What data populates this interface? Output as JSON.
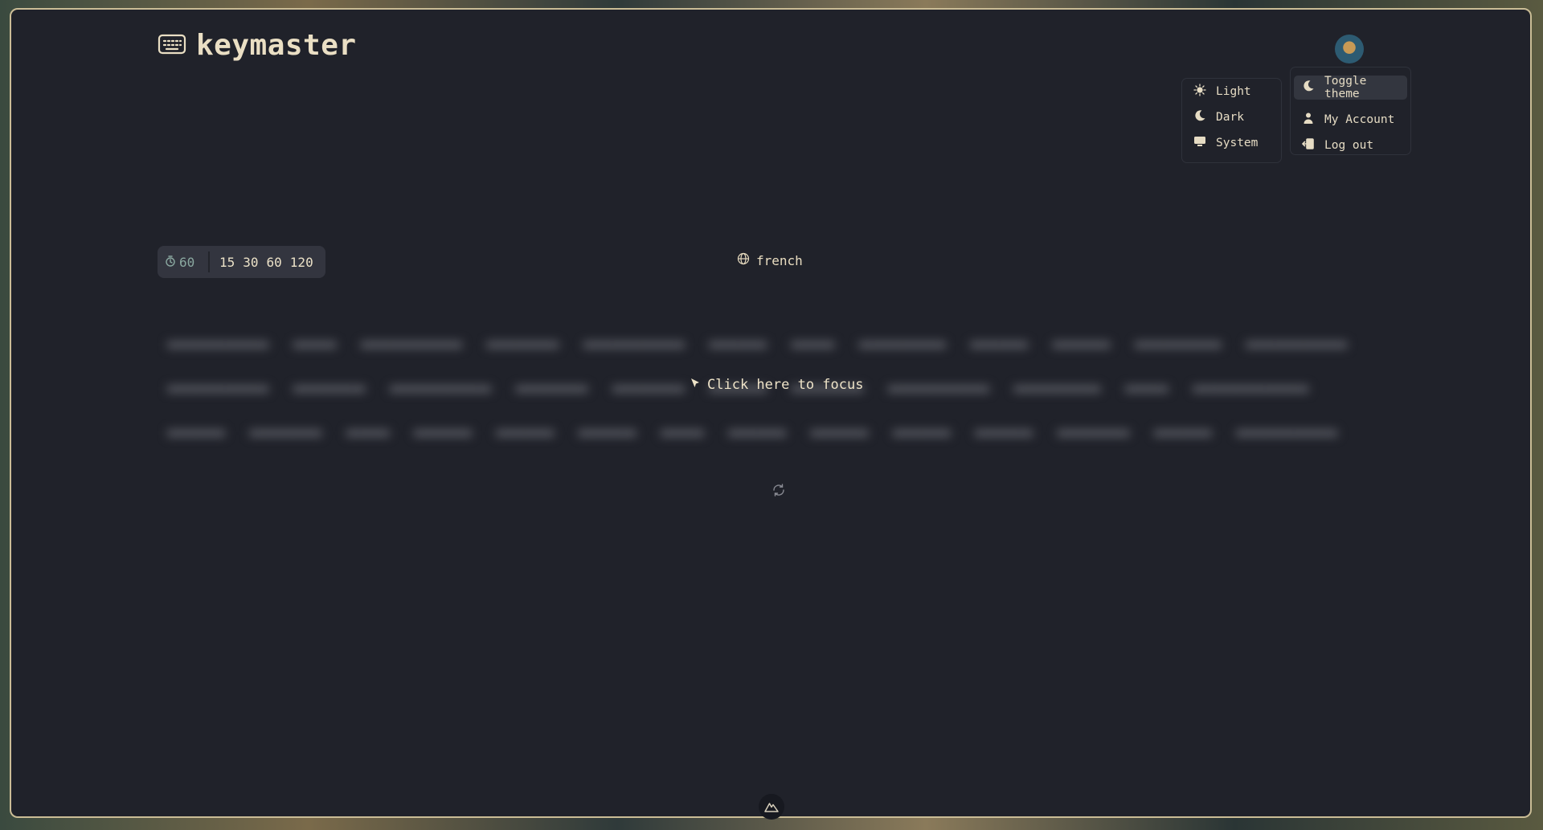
{
  "app": {
    "title": "keymaster"
  },
  "icons": {
    "logo": "keyboard-icon",
    "timer": "timer-icon",
    "language": "globe-icon",
    "focus": "cursor-icon",
    "restart": "refresh-icon",
    "bottom": "nuxt-icon"
  },
  "theme_menu": {
    "items": [
      {
        "label": "Light",
        "icon": "sun-icon"
      },
      {
        "label": "Dark",
        "icon": "moon-icon"
      },
      {
        "label": "System",
        "icon": "monitor-icon"
      }
    ]
  },
  "account_menu": {
    "items": [
      {
        "label": "Toggle theme",
        "icon": "moon-icon",
        "active": true
      },
      {
        "label": "My Account",
        "icon": "user-icon"
      },
      {
        "label": "Log out",
        "icon": "logout-icon"
      }
    ]
  },
  "timer": {
    "current": "60",
    "options": [
      "15",
      "30",
      "60",
      "120"
    ]
  },
  "language": {
    "label": "french"
  },
  "typing": {
    "focus_hint": "Click here to focus"
  },
  "colors": {
    "background": "#20222a",
    "accent": "#eadfc4",
    "muted_accent": "#8aa8a0",
    "border": "#cbbd96"
  }
}
